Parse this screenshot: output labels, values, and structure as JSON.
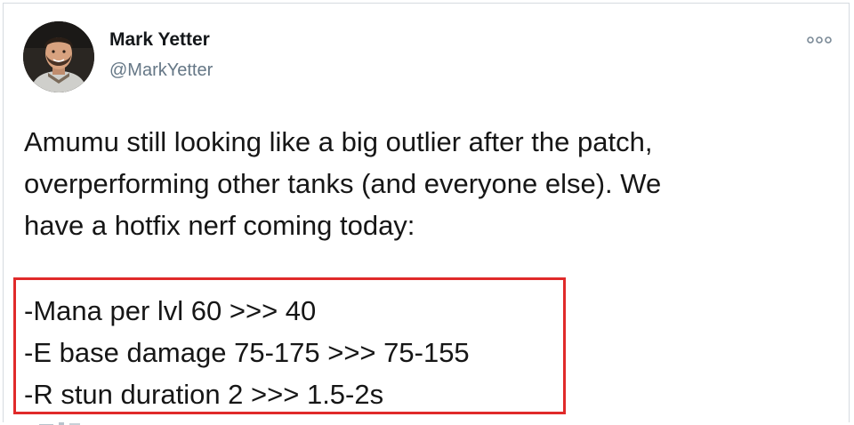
{
  "tweet": {
    "author": {
      "name": "Mark Yetter",
      "handle": "@MarkYetter",
      "avatar_icon": "profile-photo"
    },
    "more_icon": "more-options-icon",
    "text_lines": [
      "Amumu still looking like a big outlier after the patch,",
      "overperforming other tanks (and everyone else). We",
      "have a hotfix nerf coming today:"
    ],
    "changes": [
      "-Mana per lvl 60 >>> 40",
      "-E base damage 75-175 >>> 75-155",
      "-R stun duration 2 >>> 1.5-2s"
    ]
  },
  "colors": {
    "highlight_border": "#e02a2a",
    "handle": "#657786",
    "text": "#161616"
  }
}
